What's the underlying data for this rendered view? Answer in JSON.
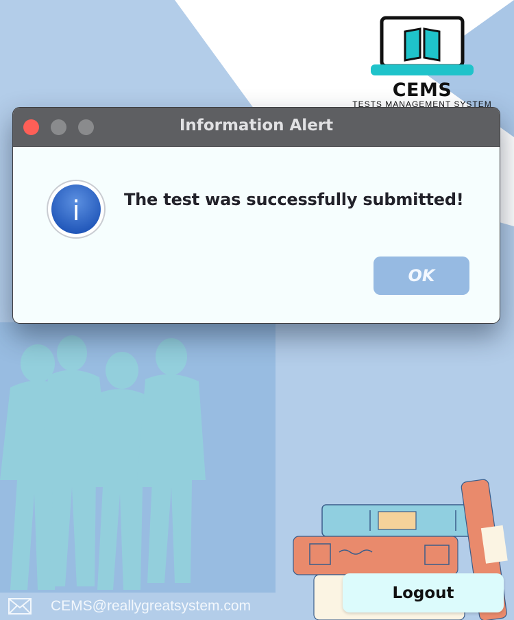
{
  "app": {
    "logo_title": "CEMS",
    "logo_subtitle": "TESTS MANAGEMENT SYSTEM"
  },
  "dialog": {
    "title": "Information Alert",
    "message": "The test was successfully submitted!",
    "ok_label": "OK",
    "icon": "info-icon"
  },
  "footer": {
    "email": "CEMS@reallygreatsystem.com",
    "logout_label": "Logout"
  },
  "colors": {
    "background": "#b3cde9",
    "dialog_body": "#f6fefe",
    "titlebar": "#5e5f62",
    "ok_button": "#96bae2",
    "logout_button": "#dcfbfc"
  }
}
